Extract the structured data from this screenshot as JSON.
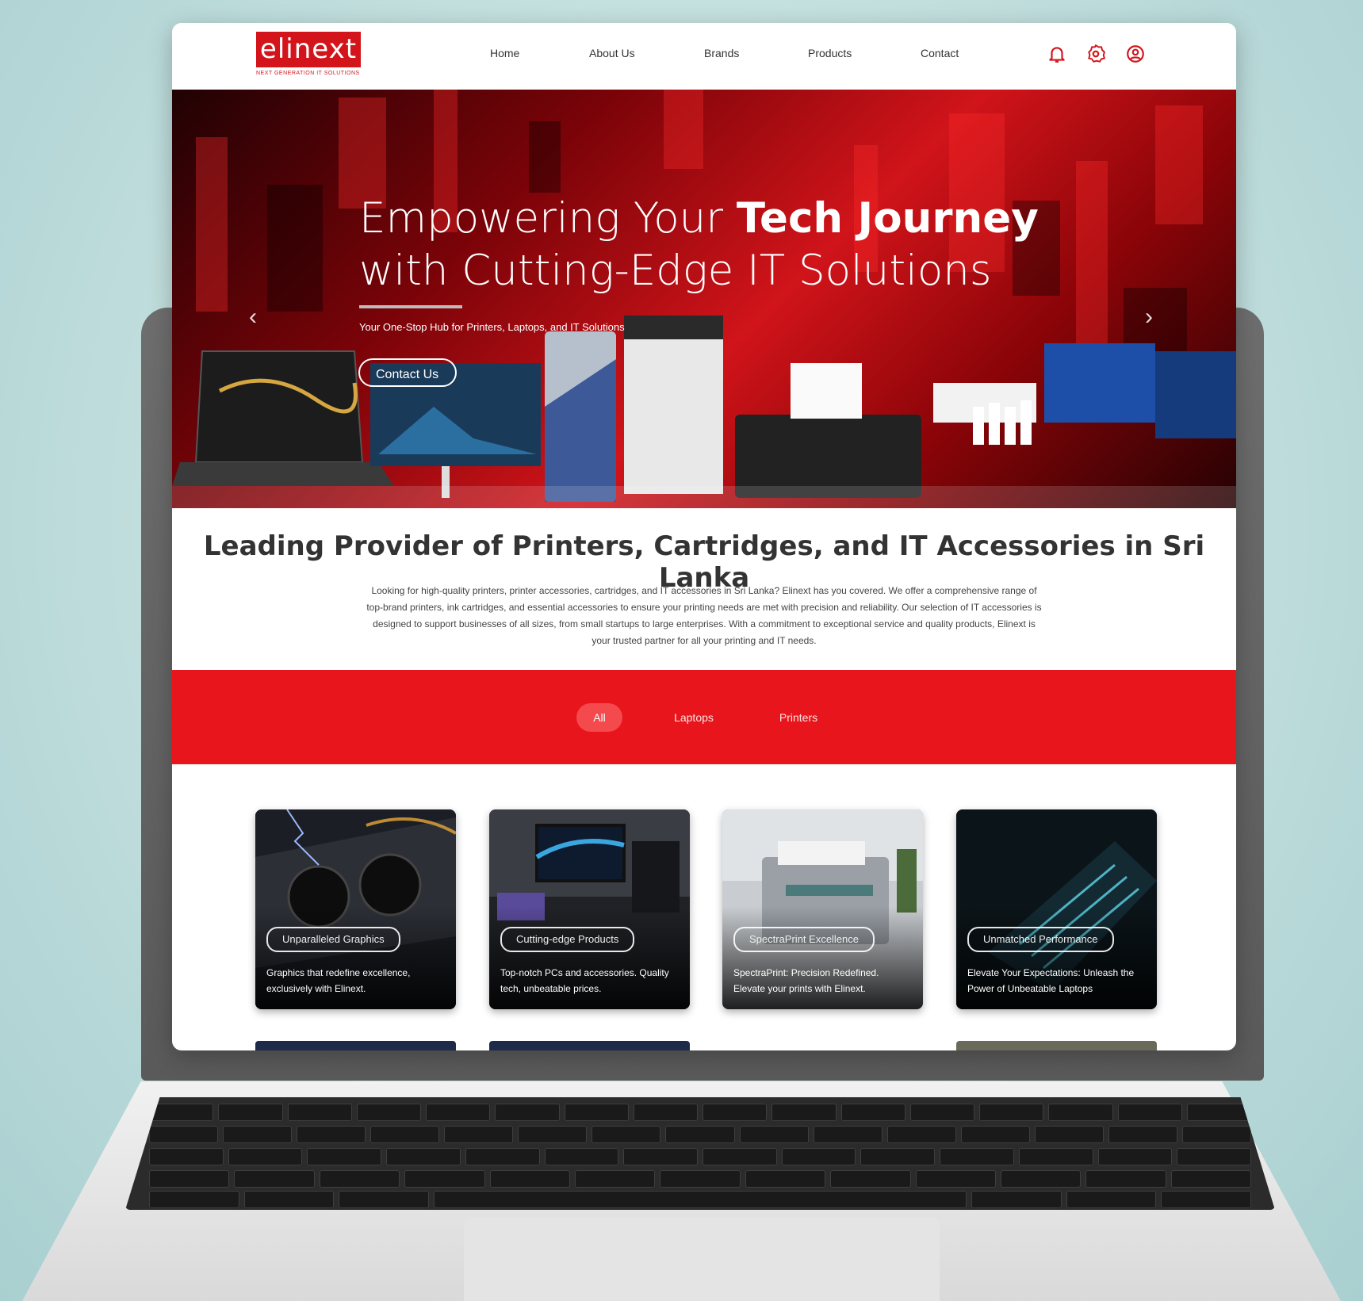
{
  "brand": {
    "logo_text": "elinext",
    "tagline": "NEXT GENERATION IT SOLUTIONS",
    "accent_color": "#e8161c"
  },
  "nav": {
    "links": [
      "Home",
      "About Us",
      "Brands",
      "Products",
      "Contact"
    ],
    "icons": [
      "bell-icon",
      "gear-icon",
      "user-icon"
    ]
  },
  "hero": {
    "title_line1_light": "Empowering Your ",
    "title_line1_bold": "Tech Journey",
    "title_line2": "with Cutting-Edge IT Solutions",
    "subtitle": "Your One-Stop Hub for Printers, Laptops, and IT Solutions",
    "cta_label": "Contact Us"
  },
  "intro": {
    "heading": "Leading Provider of Printers, Cartridges, and IT Accessories in Sri Lanka",
    "body": "Looking for high-quality printers, printer accessories, cartridges, and IT accessories in Sri Lanka? Elinext has you covered. We offer a comprehensive range of top-brand printers, ink cartridges, and essential accessories to ensure your printing needs are met with precision and reliability. Our selection of IT accessories is designed to support businesses of all sizes, from small startups to large enterprises. With a commitment to exceptional service and quality products, Elinext is your trusted partner for all your printing and IT needs."
  },
  "filters": {
    "tabs": [
      "All",
      "Laptops",
      "Printers"
    ],
    "active": "All"
  },
  "cards": [
    {
      "badge": "Unparalleled Graphics",
      "text": "Graphics that redefine excellence, exclusively with Elinext."
    },
    {
      "badge": "Cutting-edge Products",
      "text": "Top-notch PCs and accessories. Quality tech, unbeatable prices."
    },
    {
      "badge": "SpectraPrint Excellence",
      "text": "SpectraPrint: Precision Redefined. Elevate your prints with Elinext."
    },
    {
      "badge": "Unmatched Performance",
      "text": "Elevate Your Expectations: Unleash the Power of Unbeatable Laptops"
    }
  ]
}
